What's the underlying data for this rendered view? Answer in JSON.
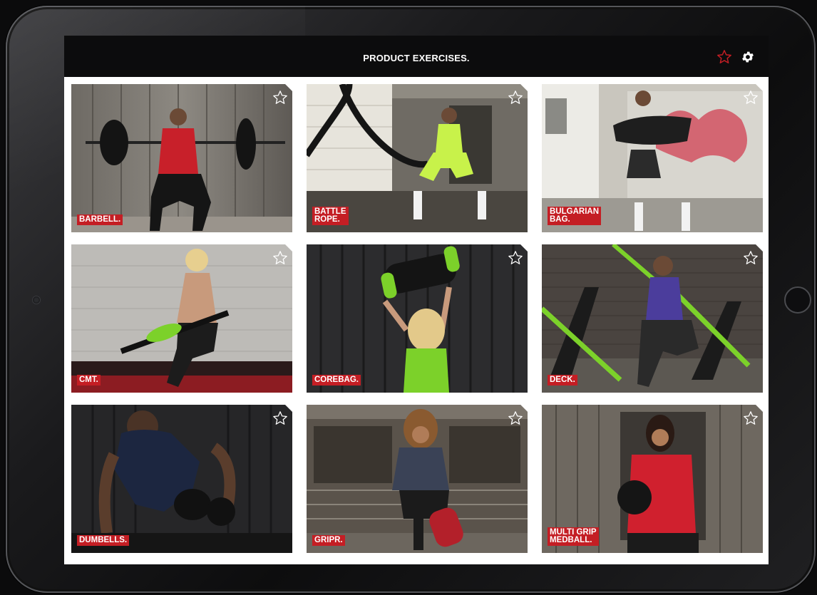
{
  "header": {
    "title": "PRODUCT EXERCISES.",
    "favorites_icon": "star-outline-icon",
    "settings_icon": "gear-icon",
    "favorites_color": "#c41e24"
  },
  "products": [
    {
      "label": "BARBELL.",
      "icon": "star-outline-icon"
    },
    {
      "label": "BATTLE\nROPE.",
      "icon": "star-outline-icon"
    },
    {
      "label": "BULGARIAN\nBAG.",
      "icon": "star-outline-icon"
    },
    {
      "label": "CMT.",
      "icon": "star-outline-icon"
    },
    {
      "label": "COREBAG.",
      "icon": "star-outline-icon"
    },
    {
      "label": "DECK.",
      "icon": "star-outline-icon"
    },
    {
      "label": "DUMBELLS.",
      "icon": "star-outline-icon"
    },
    {
      "label": "GRIPR.",
      "icon": "star-outline-icon"
    },
    {
      "label": "MULTI GRIP\nMEDBALL.",
      "icon": "star-outline-icon"
    }
  ],
  "colors": {
    "label_background": "#c41e24",
    "accent_green": "#8ae234"
  }
}
